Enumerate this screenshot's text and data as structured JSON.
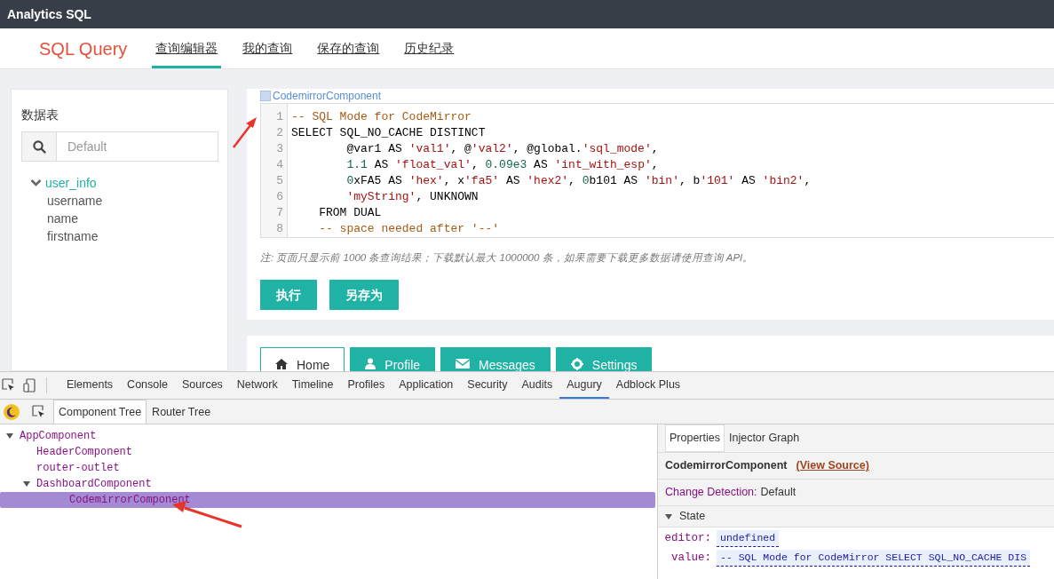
{
  "app_bar": {
    "title": "Analytics SQL"
  },
  "header": {
    "brand": "SQL Query",
    "tabs": [
      {
        "label": "查询编辑器",
        "selected": true
      },
      {
        "label": "我的查询",
        "selected": false
      },
      {
        "label": "保存的查询",
        "selected": false
      },
      {
        "label": "历史纪录",
        "selected": false
      }
    ]
  },
  "sidebar": {
    "title": "数据表",
    "search": {
      "placeholder": "Default"
    },
    "tree": [
      {
        "label": "user_info",
        "expanded": true,
        "children": [
          {
            "label": "username"
          },
          {
            "label": "name"
          },
          {
            "label": "firstname"
          }
        ]
      }
    ]
  },
  "editor": {
    "overlay_label": "CodemirrorComponent",
    "lines": [
      {
        "number": "1",
        "tokens": [
          {
            "kind": "comment",
            "text": "-- SQL Mode for CodeMirror"
          }
        ]
      },
      {
        "number": "2",
        "tokens": [
          {
            "kind": "plain",
            "text": "SELECT SQL_NO_CACHE DISTINCT"
          }
        ]
      },
      {
        "number": "3",
        "tokens": [
          {
            "kind": "plain",
            "text": "        @var1 AS "
          },
          {
            "kind": "string",
            "text": "'val1'"
          },
          {
            "kind": "plain",
            "text": ", @"
          },
          {
            "kind": "string",
            "text": "'val2'"
          },
          {
            "kind": "plain",
            "text": ", @global."
          },
          {
            "kind": "string",
            "text": "'sql_mode'"
          },
          {
            "kind": "plain",
            "text": ","
          }
        ]
      },
      {
        "number": "4",
        "tokens": [
          {
            "kind": "number",
            "text": "        1.1"
          },
          {
            "kind": "plain",
            "text": " AS "
          },
          {
            "kind": "string",
            "text": "'float_val'"
          },
          {
            "kind": "plain",
            "text": ", "
          },
          {
            "kind": "number",
            "text": "0.09e3"
          },
          {
            "kind": "plain",
            "text": " AS "
          },
          {
            "kind": "string",
            "text": "'int_with_esp'"
          },
          {
            "kind": "plain",
            "text": ","
          }
        ]
      },
      {
        "number": "5",
        "tokens": [
          {
            "kind": "number",
            "text": "        0"
          },
          {
            "kind": "plain",
            "text": "xFA5 AS "
          },
          {
            "kind": "string",
            "text": "'hex'"
          },
          {
            "kind": "plain",
            "text": ", x"
          },
          {
            "kind": "string",
            "text": "'fa5'"
          },
          {
            "kind": "plain",
            "text": " AS "
          },
          {
            "kind": "string",
            "text": "'hex2'"
          },
          {
            "kind": "plain",
            "text": ", "
          },
          {
            "kind": "number",
            "text": "0"
          },
          {
            "kind": "plain",
            "text": "b101 AS "
          },
          {
            "kind": "string",
            "text": "'bin'"
          },
          {
            "kind": "plain",
            "text": ", b"
          },
          {
            "kind": "string",
            "text": "'101'"
          },
          {
            "kind": "plain",
            "text": " AS "
          },
          {
            "kind": "string",
            "text": "'bin2'"
          },
          {
            "kind": "plain",
            "text": ","
          }
        ]
      },
      {
        "number": "6",
        "tokens": [
          {
            "kind": "string",
            "text": "        'myString'"
          },
          {
            "kind": "plain",
            "text": ", UNKNOWN"
          }
        ]
      },
      {
        "number": "7",
        "tokens": [
          {
            "kind": "plain",
            "text": "    FROM DUAL"
          }
        ]
      },
      {
        "number": "8",
        "tokens": [
          {
            "kind": "comment",
            "text": "    -- space needed after '--'"
          }
        ]
      }
    ],
    "note": "注: 页面只显示前 1000 条查询结果；下载默认最大 1000000 条，如果需要下载更多数据请使用查询 API。",
    "buttons": [
      "执行",
      "另存为"
    ]
  },
  "lower_tabs": [
    {
      "label": "Home",
      "selected": true
    },
    {
      "label": "Profile",
      "selected": false
    },
    {
      "label": "Messages",
      "selected": false
    },
    {
      "label": "Settings",
      "selected": false
    }
  ],
  "devtools": {
    "tabs": [
      {
        "label": "Elements",
        "selected": false
      },
      {
        "label": "Console",
        "selected": false
      },
      {
        "label": "Sources",
        "selected": false
      },
      {
        "label": "Network",
        "selected": false
      },
      {
        "label": "Timeline",
        "selected": false
      },
      {
        "label": "Profiles",
        "selected": false
      },
      {
        "label": "Application",
        "selected": false
      },
      {
        "label": "Security",
        "selected": false
      },
      {
        "label": "Audits",
        "selected": false
      },
      {
        "label": "Augury",
        "selected": true
      },
      {
        "label": "Adblock Plus",
        "selected": false
      }
    ],
    "subtabs": [
      {
        "label": "Component Tree",
        "selected": true
      },
      {
        "label": "Router Tree",
        "selected": false
      }
    ],
    "tree": [
      {
        "label": "AppComponent",
        "selected": false,
        "expanded": true,
        "children": [
          {
            "label": "HeaderComponent",
            "selected": false
          },
          {
            "label": "router-outlet",
            "selected": false
          },
          {
            "label": "DashboardComponent",
            "selected": false,
            "expanded": true,
            "children": [
              {
                "label": "CodemirrorComponent",
                "selected": true
              }
            ]
          }
        ]
      }
    ],
    "properties": {
      "tabs": [
        {
          "label": "Properties",
          "selected": true
        },
        {
          "label": "Injector Graph",
          "selected": false
        }
      ],
      "component": "CodemirrorComponent",
      "view_source": "(View Source)",
      "change_detection_label": "Change Detection:",
      "change_detection_value": "Default",
      "state_title": "State",
      "state_expanded": true,
      "fields": [
        {
          "key": "editor:",
          "value": "undefined"
        },
        {
          "key": "value:",
          "value": "-- SQL Mode for CodeMirror SELECT SQL_NO_CACHE DIS"
        }
      ]
    }
  }
}
